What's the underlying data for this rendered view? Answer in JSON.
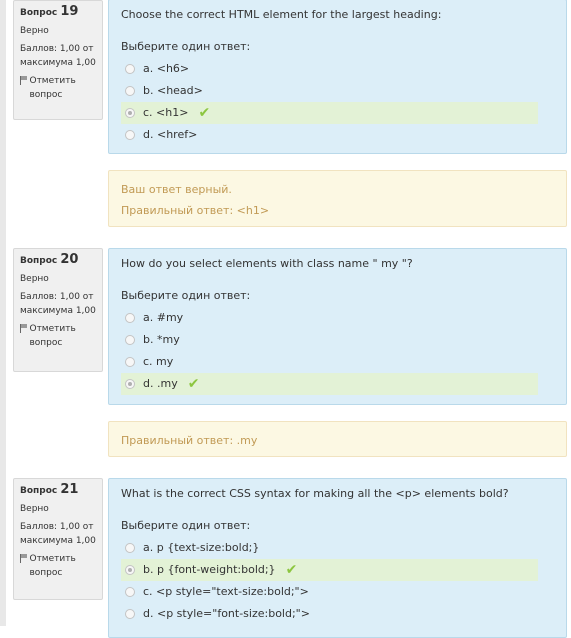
{
  "q19": {
    "label": "Вопрос",
    "number": "19",
    "state": "Верно",
    "grade": "Баллов: 1,00 от максимума 1,00",
    "flag": "Отметить вопрос",
    "text": "Choose the correct HTML element for the largest heading:",
    "prompt": "Выберите один ответ:",
    "answers": [
      "a. <h6>",
      "b. <head>",
      "c. <h1>",
      "d. <href>"
    ],
    "feedback": [
      "Ваш ответ верный.",
      "Правильный ответ: <h1>"
    ]
  },
  "q20": {
    "label": "Вопрос",
    "number": "20",
    "state": "Верно",
    "grade": "Баллов: 1,00 от максимума 1,00",
    "flag": "Отметить вопрос",
    "text": "How do you select elements with class name \" my \"?",
    "prompt": "Выберите один ответ:",
    "answers": [
      "a. #my",
      "b. *my",
      "c. my",
      "d. .my"
    ],
    "feedback": [
      "Правильный ответ: .my"
    ]
  },
  "q21": {
    "label": "Вопрос",
    "number": "21",
    "state": "Верно",
    "grade": "Баллов: 1,00 от максимума 1,00",
    "flag": "Отметить вопрос",
    "text": "What is the correct CSS syntax for making all the <p> elements bold?",
    "prompt": "Выберите один ответ:",
    "answers": [
      "a. p {text-size:bold;}",
      "b. p {font-weight:bold;}",
      "c. <p style=\"text-size:bold;\">",
      "d. <p style=\"font-size:bold;\">"
    ]
  },
  "icons": {
    "check": "✔",
    "flag": "flag-icon"
  }
}
